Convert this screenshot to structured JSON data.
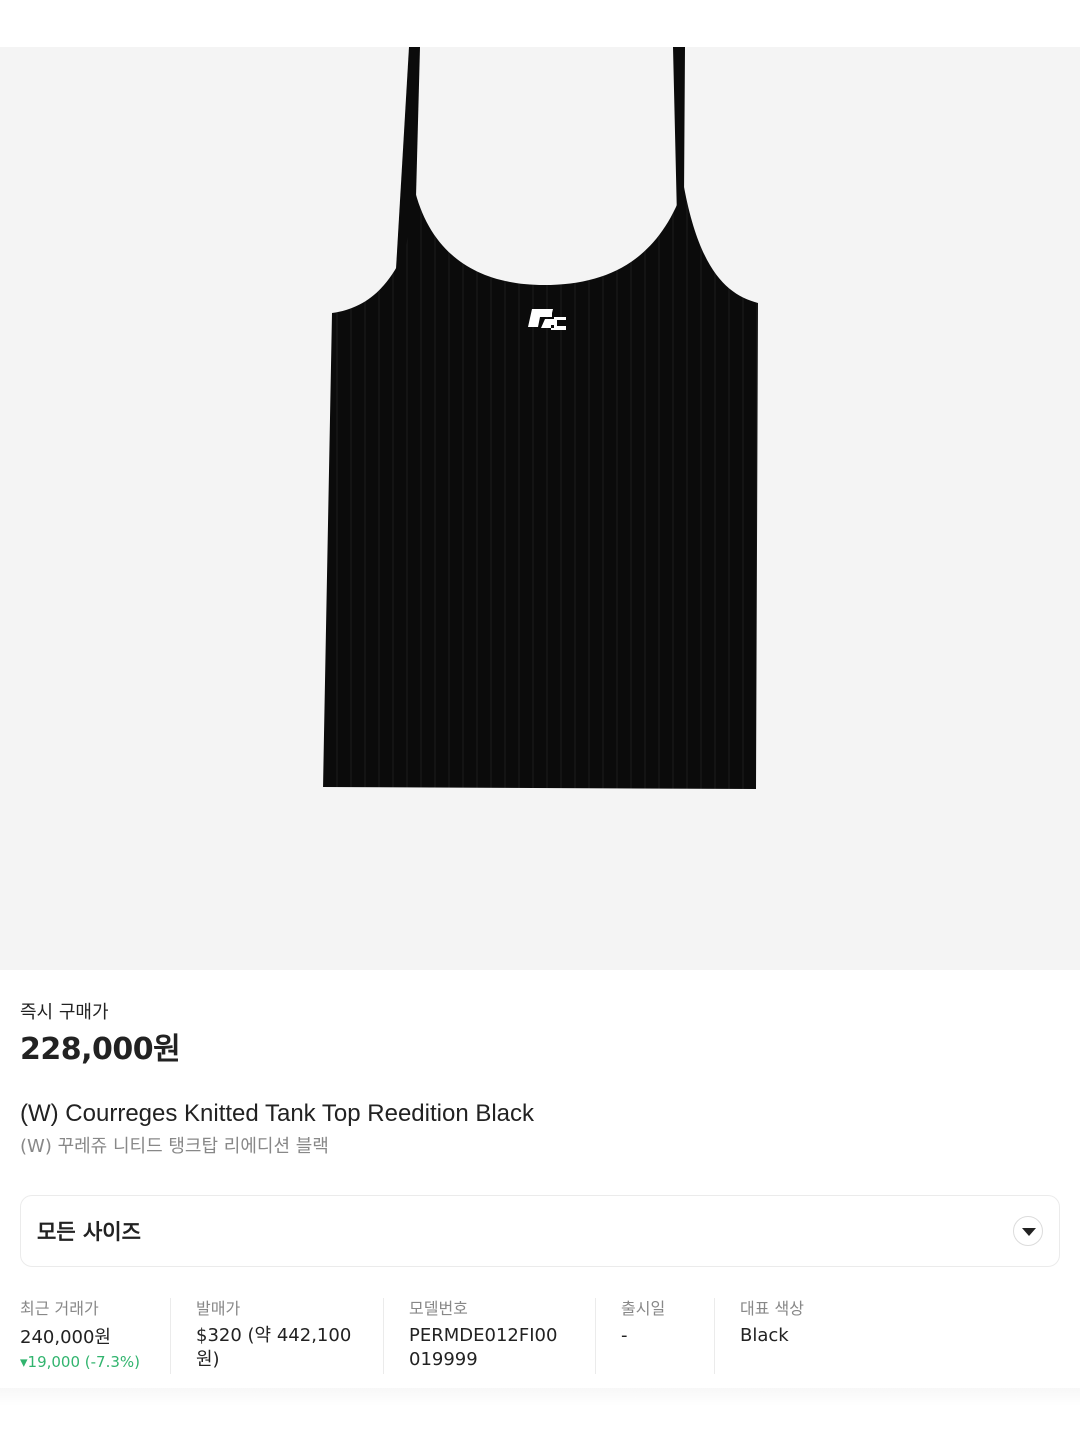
{
  "product": {
    "price_label": "즉시 구매가",
    "price": "228,000원",
    "name_en": "(W) Courreges Knitted Tank Top Reedition Black",
    "name_ko": "(W) 꾸레쥬 니티드 탱크탑 리에디션 블랙"
  },
  "size_selector": {
    "label": "모든 사이즈",
    "icon": "chevron-down-icon"
  },
  "details": {
    "recent_trade": {
      "label": "최근 거래가",
      "value": "240,000원",
      "change": "▾19,000 (-7.3%)",
      "change_color": "#31b46e"
    },
    "release_price": {
      "label": "발매가",
      "value_line1": "$320 (약 442,100",
      "value_line2": "원)"
    },
    "model_number": {
      "label": "모델번호",
      "value_line1": "PERMDE012FI00",
      "value_line2": "019999"
    },
    "release_date": {
      "label": "출시일",
      "value": "-"
    },
    "color": {
      "label": "대표 색상",
      "value": "Black"
    }
  },
  "colors": {
    "image_bg": "#f4f4f4",
    "text_primary": "#222222",
    "text_secondary": "#888888",
    "price_down": "#31b46e"
  }
}
